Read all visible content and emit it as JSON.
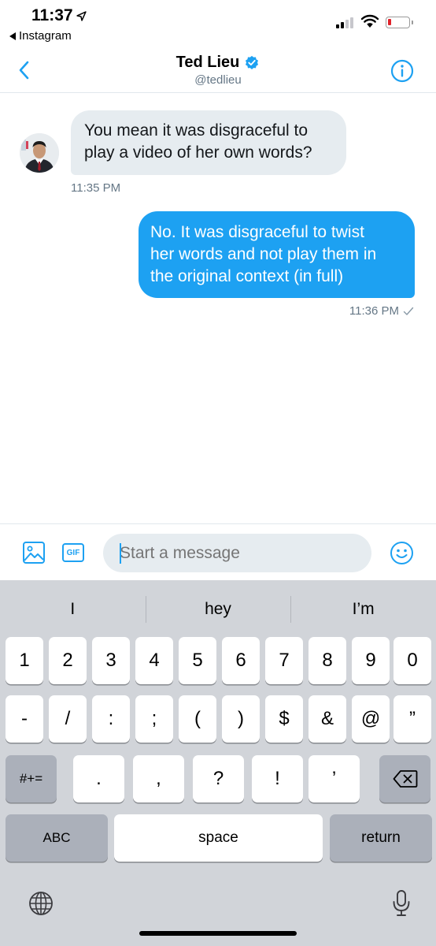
{
  "status_bar": {
    "time": "11:37",
    "back_app": "Instagram",
    "battery_color": "#e0222a"
  },
  "header": {
    "name": "Ted Lieu",
    "handle": "@tedlieu",
    "verified": true,
    "accent": "#1da1f2"
  },
  "messages": [
    {
      "direction": "incoming",
      "lines": [
        "You mean it was disgraceful to",
        "play a video of her own words?"
      ],
      "time": "11:35 PM"
    },
    {
      "direction": "outgoing",
      "lines": [
        "No. It was disgraceful to twist",
        "her words and not play them in",
        "the original context (in full)"
      ],
      "time": "11:36 PM"
    }
  ],
  "composer": {
    "placeholder": "Start a message",
    "gif_label": "GIF"
  },
  "keyboard": {
    "suggestions": [
      "I",
      "hey",
      "I’m"
    ],
    "row1": [
      "1",
      "2",
      "3",
      "4",
      "5",
      "6",
      "7",
      "8",
      "9",
      "0"
    ],
    "row2": [
      "-",
      "/",
      ":",
      ";",
      "(",
      ")",
      "$",
      "&",
      "@",
      "”"
    ],
    "row3_toggle": "#+=",
    "row3": [
      ".",
      ",",
      "?",
      "!",
      "’"
    ],
    "abc": "ABC",
    "space": "space",
    "return": "return"
  }
}
